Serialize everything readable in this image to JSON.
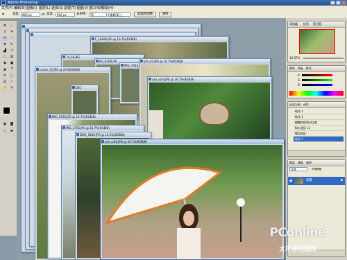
{
  "app": {
    "title": "Adobe Photoshop"
  },
  "menu": {
    "items": [
      "文件(F)",
      "编辑(E)",
      "图像(I)",
      "图层(L)",
      "选择(S)",
      "滤镜(T)",
      "视图(V)",
      "窗口(W)",
      "帮助(H)"
    ]
  },
  "options": {
    "width_label": "宽度:",
    "width_value": "800 px",
    "height_label": "高度:",
    "height_value": "600 px",
    "resolution_label": "分辨率:",
    "resolution_value": "72",
    "unit_value": "像素/英寸",
    "front_image_button": "前面的图像",
    "clear_button": "清除"
  },
  "windows": [
    {
      "title": "F_18200.JPG @ 16.7%(RGB/8)"
    },
    {
      "title": "14_58.JPG"
    },
    {
      "title": "HU_8200.JPG"
    },
    {
      "title": "IMG_7933.JPG"
    },
    {
      "title": "canon_15.JPG @ 25%(RGB/8)"
    },
    {
      "title": "yzh_02.JPG @ 16.7%(RGB/8)"
    },
    {
      "title": "yzh_rx03.JPG @ 16.7%(RGB/8)"
    },
    {
      "title": "DSC"
    },
    {
      "title": "IMG_0760.JPG @ 16.7%(RGB/8)"
    },
    {
      "title": "IMG_4755.JPG @ 16.7%(RGB/8)"
    },
    {
      "title": "DMG_9400.JPG @ 12.5%(RGB/8)"
    },
    {
      "title": "yzh_rx05.JPG @ 16.7%(RGB/8)"
    }
  ],
  "navigator": {
    "tabs": [
      "导航器",
      "信息",
      "直方图"
    ],
    "zoom": "16.67%"
  },
  "color_panel": {
    "tabs": [
      "颜色",
      "色板",
      "样式"
    ],
    "r_label": "R",
    "g_label": "G",
    "b_label": "B"
  },
  "history_panel": {
    "tabs": [
      "历史记录",
      "动作"
    ],
    "rows": [
      "动作 1",
      "动作 1",
      "调整色阶和对比度",
      "Set 选区 v1",
      "调用选区",
      "动作 1"
    ]
  },
  "layers_panel": {
    "tabs": [
      "图层",
      "通道",
      "路径"
    ],
    "mode": "正常",
    "opacity_label": "不透明度:",
    "layer_name": "背景"
  },
  "watermark": {
    "brand": "PConline",
    "sub": "太平洋电脑网"
  },
  "colors": {
    "titlebar": "#2f5f9f",
    "chrome": "#ece9d8",
    "desktop": "#8d9ea9"
  }
}
